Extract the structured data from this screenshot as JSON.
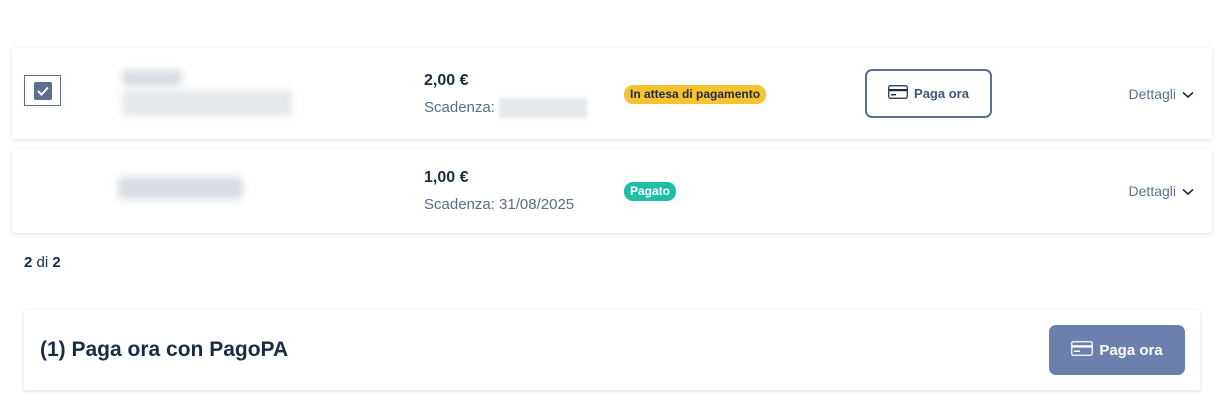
{
  "rows": [
    {
      "amount": "2,00 €",
      "due_label": "Scadenza:",
      "due_date": "",
      "status": "In attesa di pagamento",
      "pay_label": "Paga ora",
      "details_label": "Dettagli",
      "checked": true
    },
    {
      "amount": "1,00 €",
      "due_label": "Scadenza: 31/08/2025",
      "status": "Pagato",
      "details_label": "Dettagli"
    }
  ],
  "pagination": {
    "shown": "2",
    "of": "di",
    "total": "2"
  },
  "pay_bar": {
    "title": "(1) Paga ora con PagoPA",
    "button_label": "Paga ora"
  },
  "colors": {
    "accent": "#5c6f90",
    "pending": "#f7c331",
    "paid": "#1fbfa6",
    "primary_button": "#6c80ad"
  },
  "icons": {
    "checkbox": "check-icon",
    "card": "credit-card-icon",
    "expand": "chevron-down-icon"
  }
}
